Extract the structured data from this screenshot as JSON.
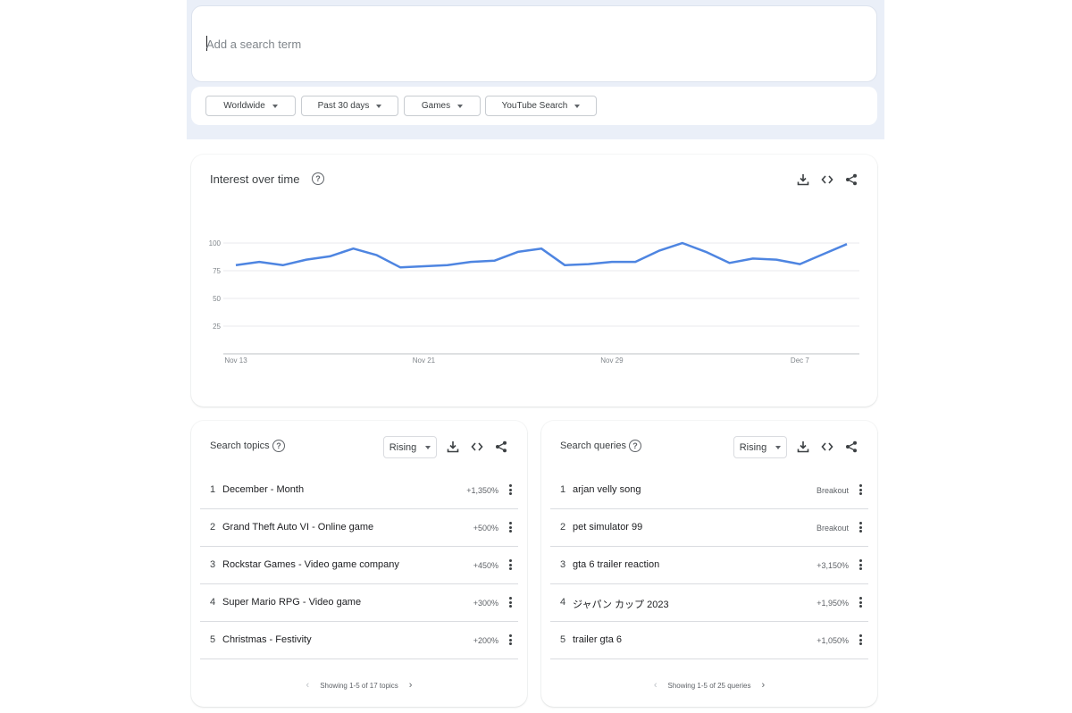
{
  "search": {
    "placeholder": "Add a search term",
    "value": ""
  },
  "filters": [
    {
      "label": "Worldwide"
    },
    {
      "label": "Past 30 days"
    },
    {
      "label": "Games"
    },
    {
      "label": "YouTube Search"
    }
  ],
  "interest": {
    "title": "Interest over time",
    "help_icon": "question-circle-icon",
    "actions": [
      "download-icon",
      "embed-code-icon",
      "share-icon"
    ]
  },
  "chart_data": {
    "type": "line",
    "title": "Interest over time",
    "xlabel": "",
    "ylabel": "",
    "ylim": [
      0,
      100
    ],
    "y_ticks": [
      "100",
      "75",
      "50",
      "25"
    ],
    "x_tick_labels": [
      "Nov 13",
      "Nov 21",
      "Nov 29",
      "Dec 7"
    ],
    "grid": true,
    "series_color": "#4e85e1",
    "series": [
      {
        "values": [
          80,
          83,
          80,
          85,
          88,
          95,
          89,
          78,
          79,
          80,
          83,
          84,
          92,
          95,
          80,
          81,
          83,
          83,
          93,
          100,
          92,
          82,
          86,
          85,
          81,
          90,
          99
        ]
      }
    ]
  },
  "topics": {
    "title": "Search topics",
    "dropdown": "Rising",
    "items": [
      {
        "rank": "1",
        "name": "December - Month",
        "value": "+1,350%"
      },
      {
        "rank": "2",
        "name": "Grand Theft Auto VI - Online game",
        "value": "+500%"
      },
      {
        "rank": "3",
        "name": "Rockstar Games - Video game company",
        "value": "+450%"
      },
      {
        "rank": "4",
        "name": "Super Mario RPG - Video game",
        "value": "+300%"
      },
      {
        "rank": "5",
        "name": "Christmas - Festivity",
        "value": "+200%"
      }
    ],
    "pager": "Showing 1-5 of 17 topics"
  },
  "queries": {
    "title": "Search queries",
    "dropdown": "Rising",
    "items": [
      {
        "rank": "1",
        "name": "arjan velly song",
        "value": "Breakout"
      },
      {
        "rank": "2",
        "name": "pet simulator 99",
        "value": "Breakout"
      },
      {
        "rank": "3",
        "name": "gta 6 trailer reaction",
        "value": "+3,150%"
      },
      {
        "rank": "4",
        "name": "ジャパン カップ 2023",
        "value": "+1,950%"
      },
      {
        "rank": "5",
        "name": "trailer gta 6",
        "value": "+1,050%"
      }
    ],
    "pager": "Showing 1-5 of 25 queries"
  }
}
